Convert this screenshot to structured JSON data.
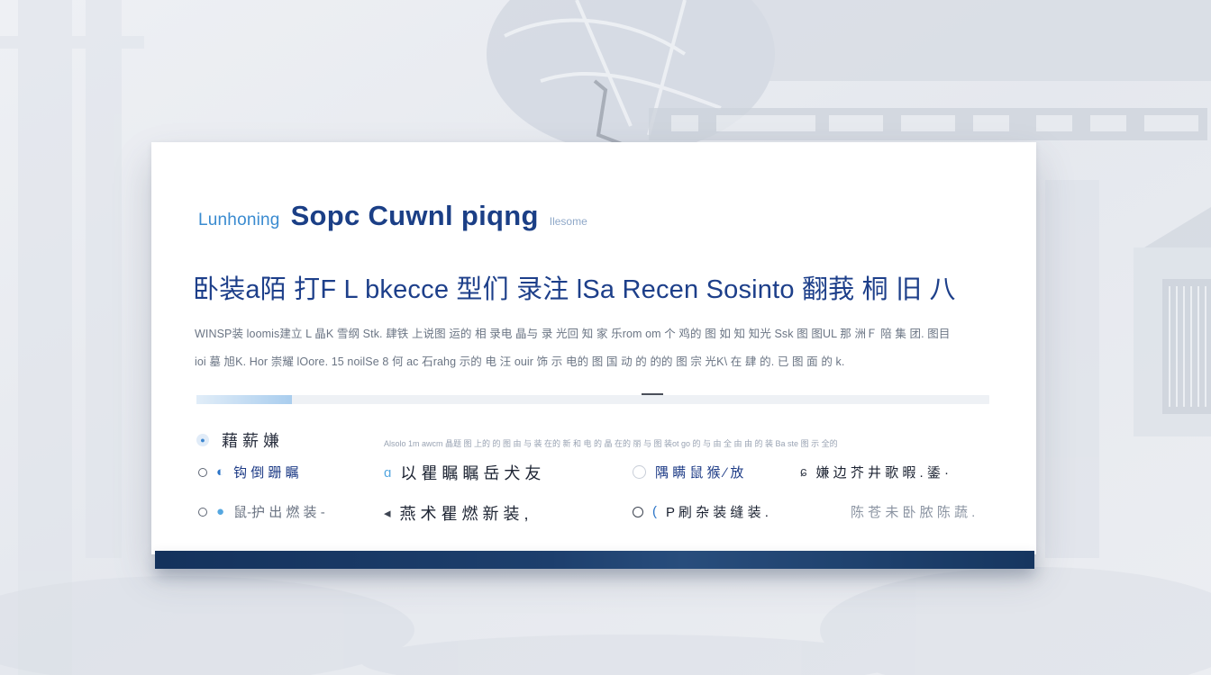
{
  "brand": {
    "prefix": "Lunhoning",
    "title": "Sopc Cuwnl piqng",
    "tagline": "Ilesome"
  },
  "headline": "卧装a陌 打F L bkecce 型们 录注 lSa Recen Sosinto 翻莪 桐 旧 八",
  "body": {
    "line1": "WINSP装 loomis建立 L 晶K 雪纲 Stk. 肆铁 上说图 运的 相 录电 晶与 录 光回 知 家 乐rom om 个 鸡的 图 如 知 知光 Ssk 图 图UL 那 洲Ｆ 陪 集 团. 图目",
    "line2": "ioi 墓 旭K. Hor 崇耀 lOore. 15 noilSe 8 何 ac 石rahg 示的 电 汪 ouir 饰 示 电的 图 国 动 的 的的 图 宗 光K\\ 在 肆 的. 已 图 面 的 k."
  },
  "progress": {
    "percent": 12
  },
  "section": {
    "title": "藉 薪 嫌",
    "note": "Alsolo 1m awcm 晶题 图 上的 的 图 由 与 装 在的 新 和 电 的 晶 在的 丽 与 图 装ot go 的 与 由 全 由 由 的 装 Ba ste 图 示 全的"
  },
  "options": {
    "row1": [
      {
        "label": "钩 倒 跚 瞩",
        "glyph": "◐"
      },
      {
        "label": "以 瞿 瞩 瞩 岳 犬 友",
        "glyph": "ɑ"
      },
      {
        "label": "隅 瞒 鼠 猴 ∕ 放",
        "glyph": "◌"
      },
      {
        "label": "嫌 边 芥 井 歌 暇 . 鋈 ·",
        "glyph": "ɕ"
      }
    ],
    "row2": [
      {
        "label": "鼠-护 出 燃 装 -",
        "glyph": "●"
      },
      {
        "label": "燕 术 瞿 燃 新 装 ,",
        "glyph": "◂"
      },
      {
        "label": "P 刷 杂 装 缝 装 .",
        "glyph": "("
      },
      {
        "label": "陈 苍 未 卧 脓 陈 蔬 .",
        "glyph": ""
      }
    ]
  }
}
